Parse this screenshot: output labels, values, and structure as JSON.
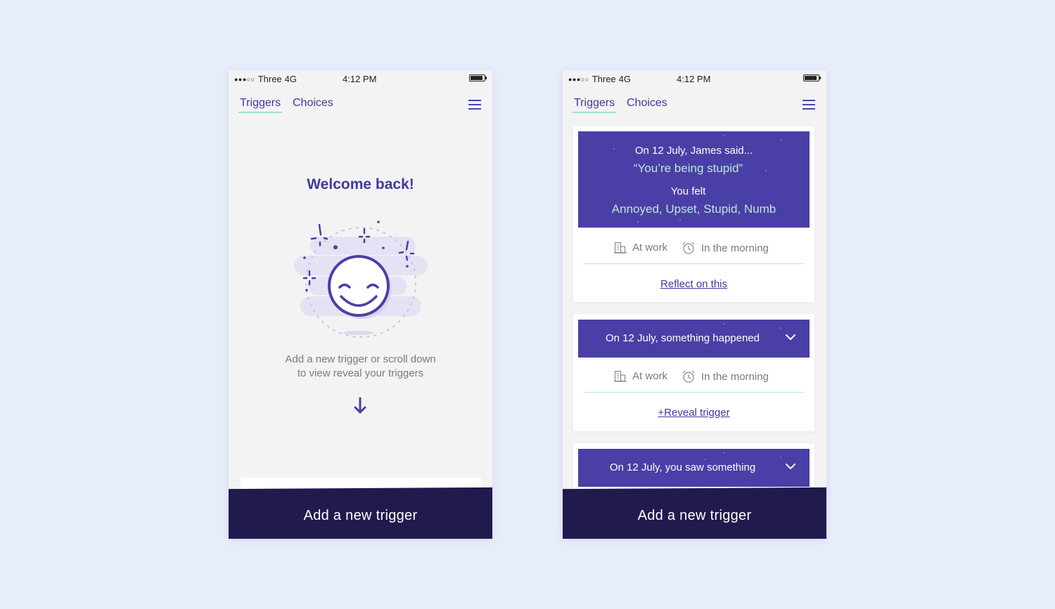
{
  "status_bar": {
    "carrier": "Three",
    "network": "4G",
    "time": "4:12 PM"
  },
  "nav": {
    "tabs": [
      "Triggers",
      "Choices"
    ]
  },
  "left_screen": {
    "welcome": "Welcome back!",
    "hint_line1": "Add a new trigger or scroll down",
    "hint_line2": "to view reveal your triggers",
    "footer_button": "Add a new trigger"
  },
  "right_screen": {
    "cards": [
      {
        "line1": "On 12 July, James said...",
        "quote": "“You’re being stupid”",
        "felt_label": "You felt",
        "feelings": "Annoyed, Upset, Stupid, Numb",
        "place": "At work",
        "time": "In the morning",
        "link": "Reflect on this"
      },
      {
        "title": "On 12 July, something happened",
        "place": "At work",
        "time": "In the morning",
        "link": "+Reveal trigger"
      },
      {
        "title": "On 12 July, you saw something"
      }
    ],
    "footer_button": "Add a new trigger"
  },
  "colors": {
    "background": "#e8edfc",
    "accent": "#3f3aa0",
    "banner": "#4a3fa6",
    "footer": "#211a4d",
    "mint": "#b9e8d7"
  },
  "icons": [
    "menu-icon",
    "building-icon",
    "alarm-clock-icon",
    "arrow-down-icon",
    "chevron-down-icon",
    "smiley-face-icon",
    "sparkle-icon"
  ]
}
